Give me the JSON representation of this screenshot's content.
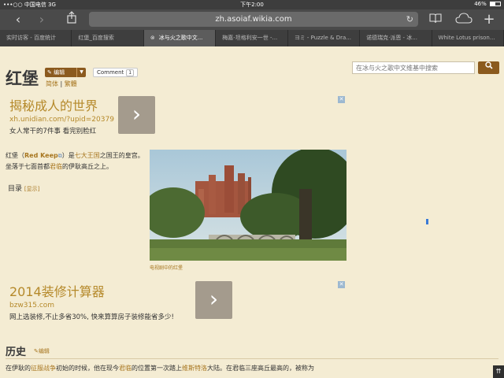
{
  "status_bar": {
    "carrier": "•••○○ 中国电信  3G",
    "time": "下午2:00",
    "battery": "46%",
    "battery_level": 0.46
  },
  "toolbar": {
    "url": "zh.asoiaf.wikia.com"
  },
  "tabs": [
    {
      "label": "实时访客 - 百度统计",
      "active": false
    },
    {
      "label": "红堡_百度搜索",
      "active": false
    },
    {
      "label": "冰与火之歌中文...",
      "active": true
    },
    {
      "label": "梅嘉-坦格利安一世 -...",
      "active": false
    },
    {
      "label": "ヨミ - Puzzle & Dra...",
      "active": false
    },
    {
      "label": "诺德瑞克·派恩 - 冰...",
      "active": false
    },
    {
      "label": "White Lotus prison...",
      "active": false
    }
  ],
  "article": {
    "title": "红堡",
    "edit_label": "编辑",
    "comment_label": "Comment",
    "comment_count": "1",
    "variant_simplified": "简体",
    "variant_separator": "|",
    "variant_traditional": "繁體",
    "search_placeholder": "在冰与火之歌中文维基中搜索",
    "intro": {
      "part1": "红堡（",
      "link_name": "Red Keep",
      "part2": "）是",
      "link_kingdoms": "七大王国",
      "part3": "之国王的皇宫。坐落于七面首都",
      "link_capital": "君临",
      "part4": "的伊耿高丘之上。"
    },
    "toc_label": "目录",
    "toc_show": "[显示]",
    "image_caption": "电视剧中的红堡",
    "history_heading": "历史",
    "history_edit": "编辑",
    "history_text": {
      "part1": "在伊耿的",
      "link_conquest": "征服战争",
      "part2": "初始的时候，他在现今",
      "link_city": "君临",
      "part3": "的位置第一次踏上",
      "link_westeros": "维斯特洛",
      "part4": "大陆。在君临三座高丘最高的，被称为"
    }
  },
  "ads": [
    {
      "headline": "揭秘成人的世界",
      "url": "xh.unidian.com/?upid=20379",
      "description": "女人常干的7件事 看完别脸红"
    },
    {
      "headline": "2014装修计算器",
      "url": "bzw315.com",
      "description": "网上选装修,不止多省30%, 快来算算房子装修能省多少!"
    }
  ],
  "colors": {
    "page_bg": "#f4ecd3",
    "link": "#a77620",
    "button_brown": "#8b5a1e",
    "ad_headline": "#b5892a"
  }
}
